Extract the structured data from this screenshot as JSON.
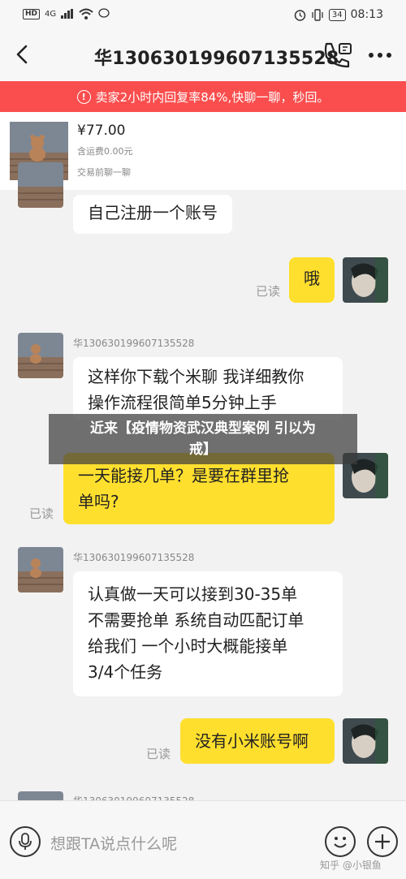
{
  "status_bar": {
    "network": "HD",
    "signal": "4G",
    "battery": "34",
    "time": "08:13"
  },
  "header": {
    "title": "华13063019960713552​8",
    "back_icon": "chevron-left-icon",
    "call_icon": "phone-icon",
    "more_icon": "more-icon"
  },
  "alert": {
    "icon": "!",
    "text": "卖家2小时内回复率84%,快聊一聊，秒回。"
  },
  "product": {
    "price": "¥77.00",
    "shipping": "含运费0.00元",
    "hint": "交易前聊一聊"
  },
  "chat": {
    "sender_name": "华130630199607135528",
    "read_label": "已读",
    "messages": [
      {
        "side": "left",
        "text": "自己注册一个账号"
      },
      {
        "side": "right",
        "text": "哦",
        "read": "已读"
      },
      {
        "side": "left",
        "name": "华130630199607135528",
        "lines": [
          "这样你下载个米聊 我详细教你",
          "操作流程很简单5分钟上手"
        ]
      },
      {
        "side": "right",
        "lines": [
          "一天能接几单？是要在群里抢",
          "单吗?"
        ],
        "read": "已读"
      },
      {
        "side": "left",
        "name": "华130630199607135528",
        "lines": [
          "认真做一天可以接到30-35单",
          "不需要抢单 系统自动匹配订单",
          "给我们 一个小时大概能接单",
          "3/4个任务"
        ]
      },
      {
        "side": "right",
        "text": "没有小米账号啊",
        "read": "已读"
      }
    ],
    "partial_name": "华130630199607135528"
  },
  "watermark": {
    "line1": "近来【疫情物资武汉典型案例 引以为",
    "line2": "戒】"
  },
  "input": {
    "placeholder": "想跟TA说点什么呢",
    "mic_icon": "microphone-icon",
    "emoji_icon": "smiley-icon",
    "plus_icon": "plus-icon"
  },
  "credit": "知乎 @小银鱼"
}
